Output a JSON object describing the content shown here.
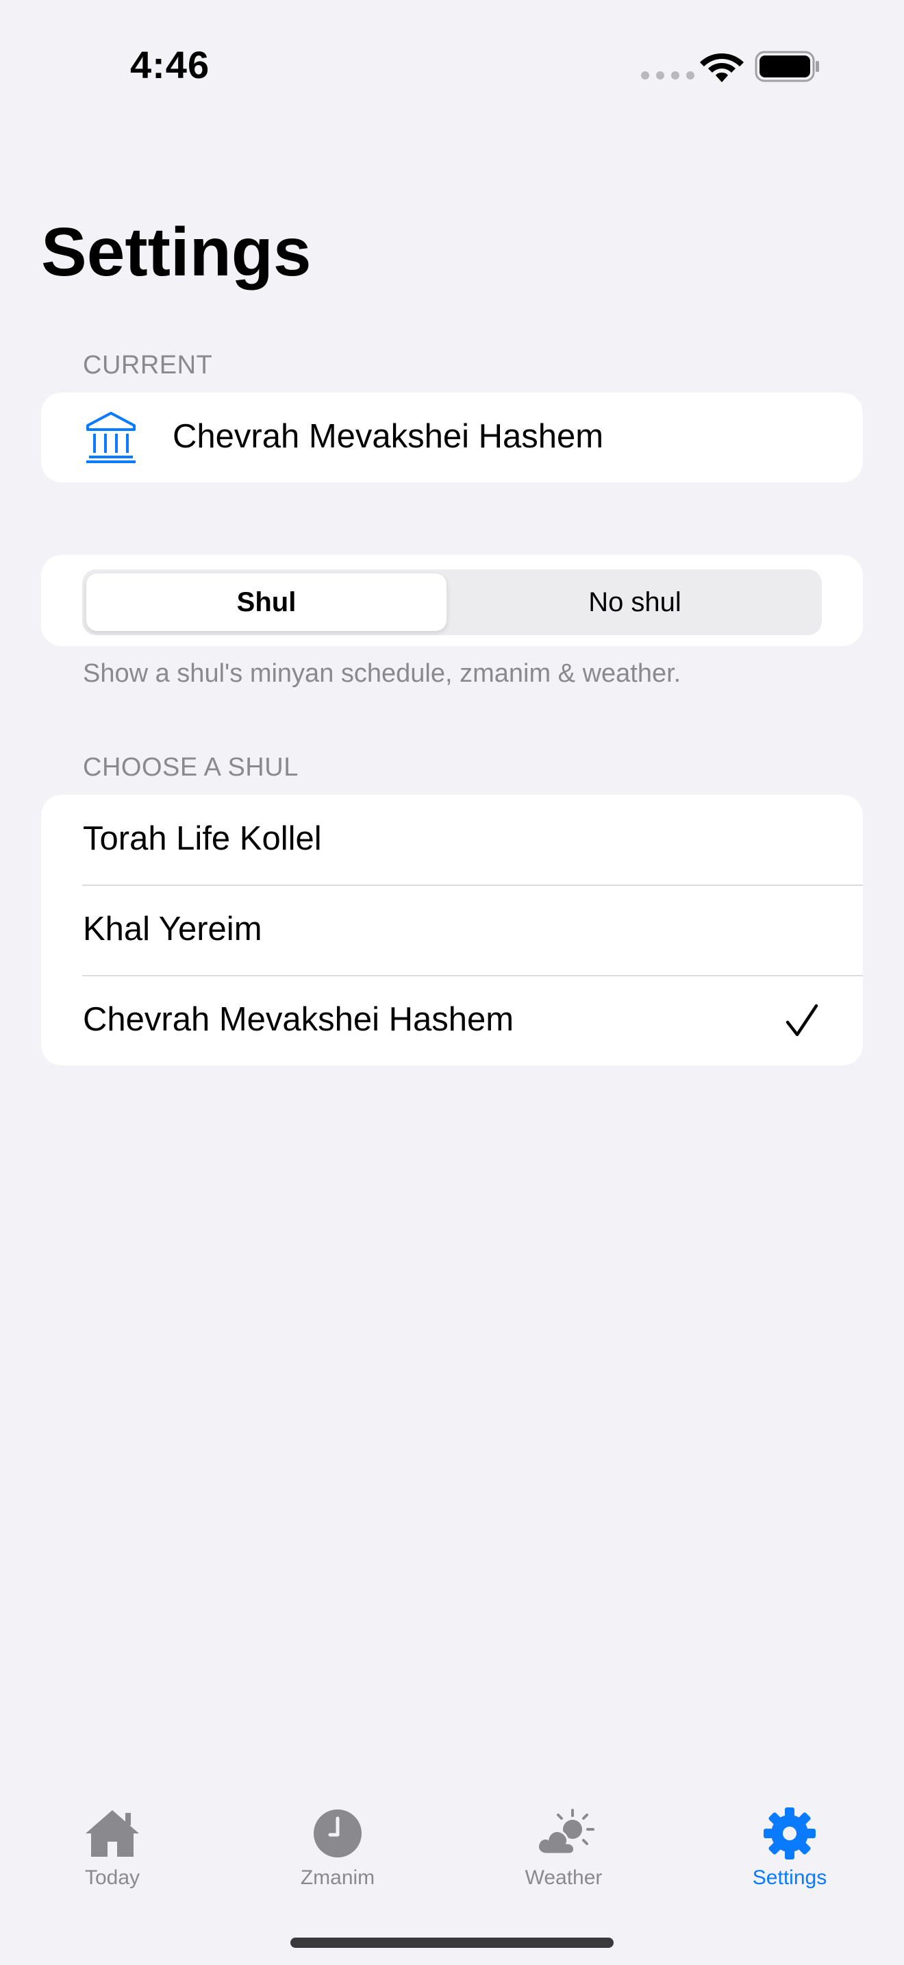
{
  "status_bar": {
    "time": "4:46"
  },
  "page": {
    "title": "Settings"
  },
  "current_section": {
    "header": "CURRENT",
    "shul_name": "Chevrah Mevakshei Hashem",
    "icon": "building-columns-icon"
  },
  "shul_mode": {
    "options": [
      "Shul",
      "No shul"
    ],
    "selected": "Shul",
    "footer": "Show a shul's minyan schedule, zmanim & weather."
  },
  "choose_section": {
    "header": "CHOOSE A SHUL",
    "items": [
      {
        "label": "Torah Life Kollel",
        "selected": false
      },
      {
        "label": "Khal Yereim",
        "selected": false
      },
      {
        "label": "Chevrah Mevakshei Hashem",
        "selected": true
      }
    ]
  },
  "tab_bar": {
    "tabs": [
      {
        "label": "Today",
        "icon": "house-icon",
        "active": false
      },
      {
        "label": "Zmanim",
        "icon": "clock-icon",
        "active": false
      },
      {
        "label": "Weather",
        "icon": "cloud-sun-icon",
        "active": false
      },
      {
        "label": "Settings",
        "icon": "gear-icon",
        "active": true
      }
    ]
  },
  "colors": {
    "accent": "#0a7aff",
    "background": "#f2f2f7",
    "secondary_text": "#8a8a8e"
  }
}
